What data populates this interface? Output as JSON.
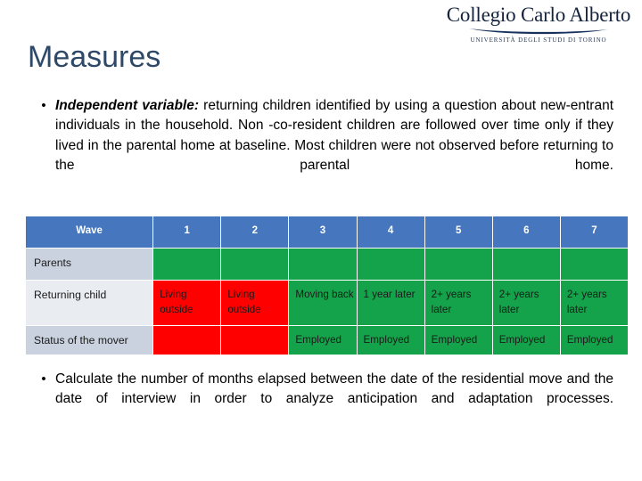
{
  "logo": {
    "wordmark": "Collegio Carlo Alberto",
    "subtitle": "UNIVERSITÀ DEGLI STUDI DI TORINO"
  },
  "title": "Measures",
  "bullets": [
    {
      "marker": "•",
      "lead": "Independent variable:",
      "text": " returning children identified by using a question about new-entrant individuals in the household. Non -co-resident children are followed over time only if they lived in the parental home at baseline. Most children were not observed before returning to the parental home."
    },
    {
      "marker": "•",
      "lead": "",
      "text": "Calculate the number of months elapsed between the date of the residential move and the date of interview in order to analyze anticipation and adaptation processes."
    }
  ],
  "table": {
    "header": {
      "label": "Wave",
      "waves": [
        "1",
        "2",
        "3",
        "4",
        "5",
        "6",
        "7"
      ]
    },
    "rows": [
      {
        "label": "Parents",
        "cells": [
          {
            "text": "",
            "state": "green"
          },
          {
            "text": "",
            "state": "green"
          },
          {
            "text": "",
            "state": "green"
          },
          {
            "text": "",
            "state": "green"
          },
          {
            "text": "",
            "state": "green"
          },
          {
            "text": "",
            "state": "green"
          },
          {
            "text": "",
            "state": "green"
          }
        ]
      },
      {
        "label": "Returning child",
        "cells": [
          {
            "text": "Living outside",
            "state": "red"
          },
          {
            "text": "Living outside",
            "state": "red"
          },
          {
            "text": "Moving back",
            "state": "green"
          },
          {
            "text": "1 year later",
            "state": "green"
          },
          {
            "text": "2+ years later",
            "state": "green"
          },
          {
            "text": "2+ years later",
            "state": "green"
          },
          {
            "text": "2+ years later",
            "state": "green"
          }
        ]
      },
      {
        "label": "Status of the mover",
        "cells": [
          {
            "text": "",
            "state": "red"
          },
          {
            "text": "",
            "state": "red"
          },
          {
            "text": "Employed",
            "state": "green"
          },
          {
            "text": "Employed",
            "state": "green"
          },
          {
            "text": "Employed",
            "state": "green"
          },
          {
            "text": "Employed",
            "state": "green"
          },
          {
            "text": "Employed",
            "state": "green"
          }
        ]
      }
    ]
  },
  "colors": {
    "header_blue": "#4677BE",
    "green": "#14A34A",
    "red": "#FE0000",
    "label_shade_dark": "#C9D2DE",
    "label_shade_light": "#E9EDF2",
    "title_navy": "#2E4868"
  }
}
